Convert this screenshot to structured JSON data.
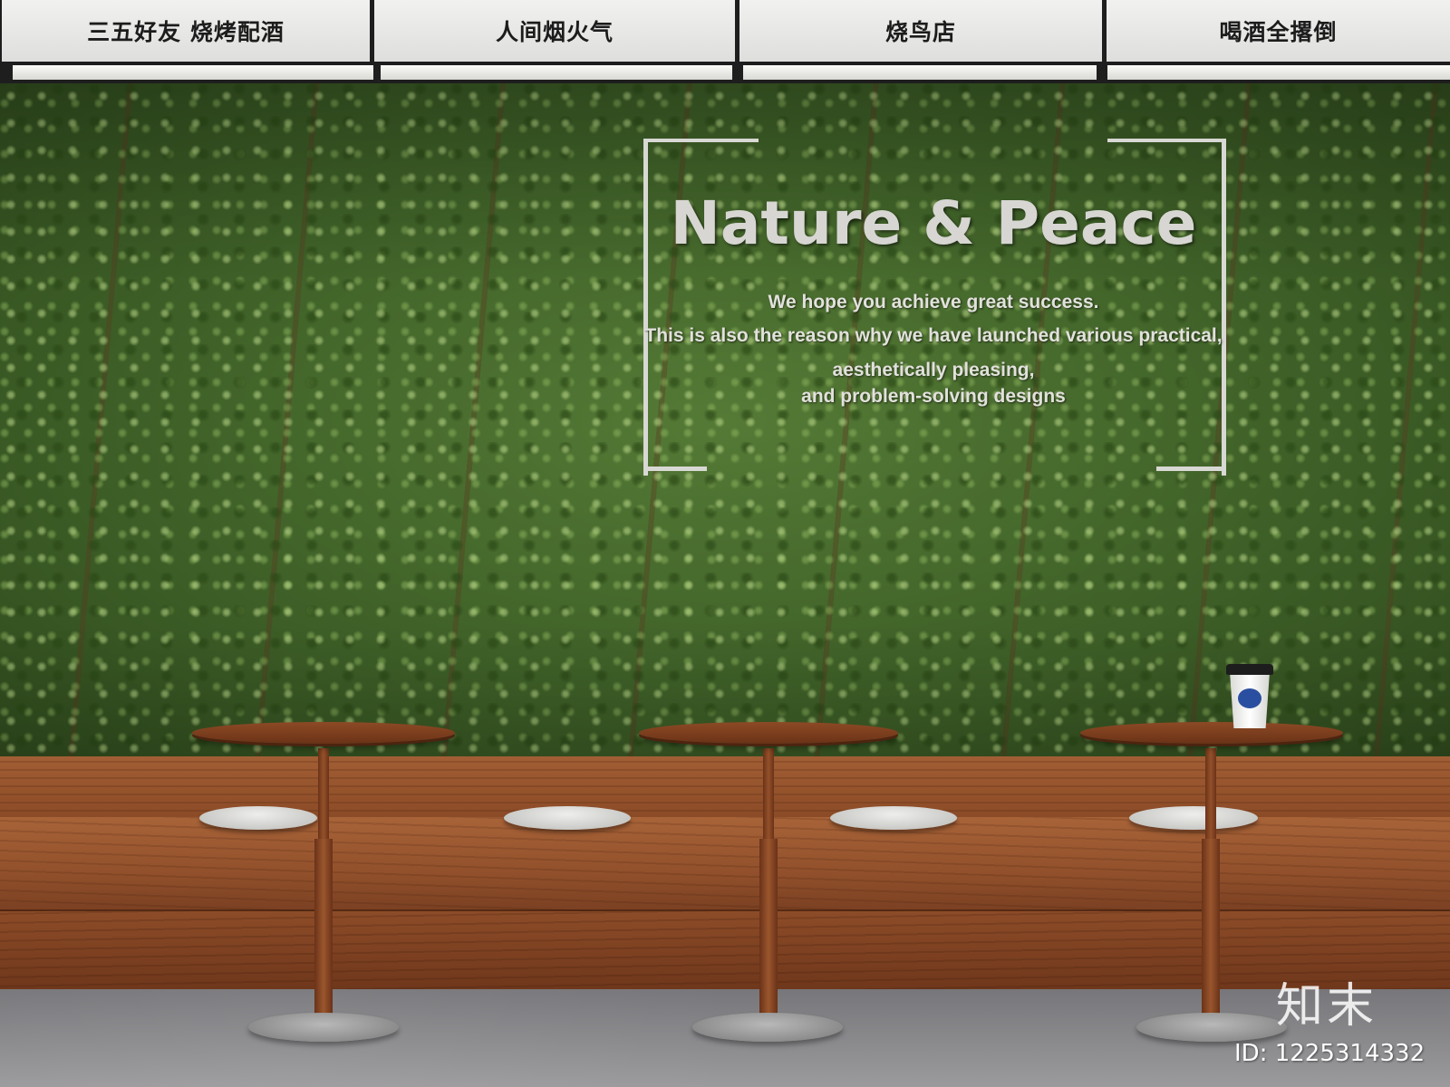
{
  "signboard": {
    "panels": [
      "三五好友 烧烤配酒",
      "人间烟火气",
      "烧鸟店",
      "喝酒全撂倒"
    ]
  },
  "wall_sign": {
    "title": "Nature & Peace",
    "lines": [
      "We hope you achieve great success.",
      "This is also the reason why we have launched various practical,",
      "aesthetically pleasing,",
      "and problem-solving designs"
    ]
  },
  "watermark": {
    "logo_text": "知末",
    "id_text": "ID: 1225314332"
  },
  "colors": {
    "wall_green": "#3f6128",
    "wood": "#91502b",
    "signboard_text": "#1c1c1c",
    "wall_text": "#d7d6d2"
  }
}
